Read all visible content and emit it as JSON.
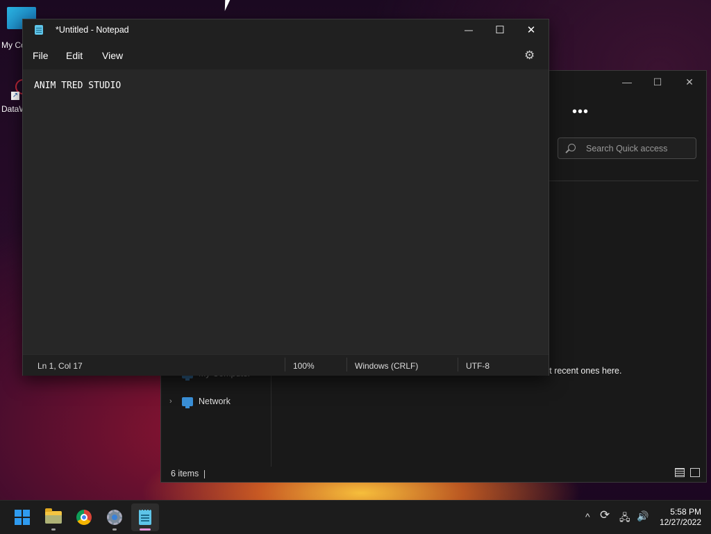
{
  "desktop": {
    "icons": [
      {
        "label": "My Co"
      },
      {
        "label": "DataW"
      }
    ]
  },
  "explorer": {
    "search_placeholder": "Search Quick access",
    "more_label": "•••",
    "nav": [
      {
        "label": "My Computer"
      },
      {
        "label": "Network"
      }
    ],
    "recent_text": "st recent ones here.",
    "status": "6 items"
  },
  "notepad": {
    "title": "*Untitled - Notepad",
    "menu": {
      "file": "File",
      "edit": "Edit",
      "view": "View"
    },
    "content": "ANIM TRED STUDIO",
    "status": {
      "position": "Ln 1, Col 17",
      "zoom": "100%",
      "line_ending": "Windows (CRLF)",
      "encoding": "UTF-8"
    },
    "controls": {
      "minimize": "—",
      "maximize": "☐",
      "close": "✕"
    }
  },
  "taskbar": {
    "apps": [
      "start",
      "file-explorer",
      "chrome",
      "settings",
      "notepad"
    ],
    "active_app": "notepad",
    "clock": {
      "time": "5:58 PM",
      "date": "12/27/2022"
    },
    "tray": {
      "chevron": "^",
      "sync": "⟳",
      "network": "🖧",
      "volume": "🔊"
    }
  }
}
